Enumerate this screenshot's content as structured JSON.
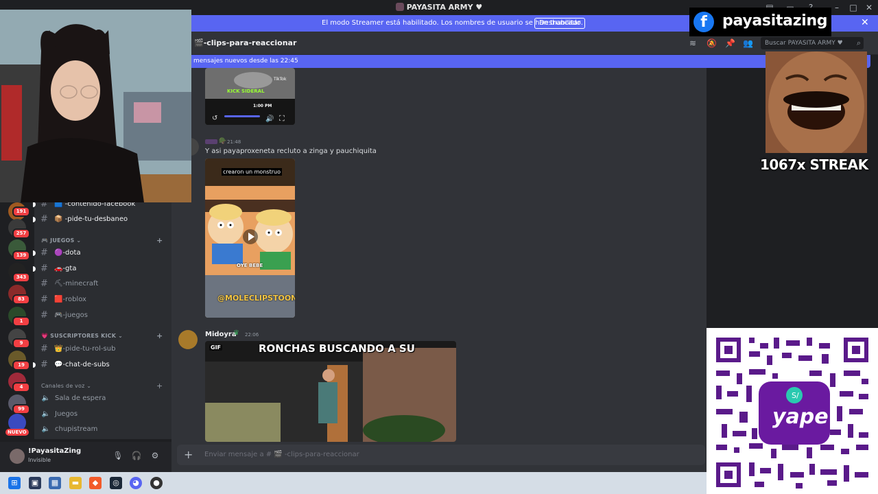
{
  "window": {
    "title": "PAYASITA ARMY ♥"
  },
  "banner": {
    "message": "El modo Streamer está habilitado. Los nombres de usuario se han truncado.",
    "button": "Deshabilitar"
  },
  "header": {
    "channel": "-clips-para-reaccionar",
    "search_placeholder": "Buscar PAYASITA ARMY ♥"
  },
  "new_messages": "mensajes nuevos desde las 22:45",
  "messages": [
    {
      "author": "",
      "time": "21:48",
      "text": "Y asi payaproxeneta recluto a zinga y pauchiquita",
      "video_caption": "crearon un monstruo",
      "video_bottom": "@MOLECLIPSTOON",
      "video_sub": "OYE BEBE"
    },
    {
      "author": "Midoyra",
      "time": "22:06",
      "gif_tag": "GIF",
      "gif_caption": "RONCHAS BUSCANDO A SU"
    }
  ],
  "top_video": {
    "tiktok": "TikTok",
    "brand": "KICK SIDERAL",
    "time": "1:00 PM"
  },
  "channels": {
    "items": [
      {
        "label": "-contenido-facebook",
        "emoji": "🟦"
      },
      {
        "label": "-pide-tu-desbaneo",
        "emoji": "📦"
      }
    ],
    "categories": [
      {
        "name": "JUEGOS",
        "items": [
          {
            "label": "-dota",
            "emoji": "🟣",
            "bright": true
          },
          {
            "label": "-gta",
            "emoji": "🚗",
            "bright": true
          },
          {
            "label": "-minecraft",
            "emoji": "⛏",
            "bright": false
          },
          {
            "label": "-roblox",
            "emoji": "🟥",
            "bright": false
          },
          {
            "label": "-juegos",
            "emoji": "🎮",
            "bright": false
          }
        ]
      },
      {
        "name": "SUSCRIPTORES KICK",
        "items": [
          {
            "label": "-pide-tu-rol-sub",
            "emoji": "👑",
            "bright": false
          },
          {
            "label": "-chat-de-subs",
            "emoji": "💬",
            "bright": true
          }
        ]
      }
    ],
    "voice_category": "Canales de voz",
    "voice": [
      "Sala de espera",
      "Juegos",
      "chupistream"
    ]
  },
  "servers": {
    "badges": [
      "191",
      "257",
      "139",
      "343",
      "83",
      "1",
      "9",
      "19",
      "4",
      "99"
    ],
    "new_label": "NUEVO"
  },
  "user": {
    "name": "!PayasitaZing",
    "status": "Invisible"
  },
  "input": {
    "placeholder": "Enviar mensaje a # 🎬 -clips-para-reaccionar"
  },
  "overlays": {
    "facebook_name": "payasitazing",
    "streak": "1067x STREAK",
    "qr_brand": "yape"
  },
  "colors": {
    "accent": "#5865f2",
    "badge": "#f23f43",
    "facebook": "#1877f2",
    "qr": "#5a1a8a"
  }
}
